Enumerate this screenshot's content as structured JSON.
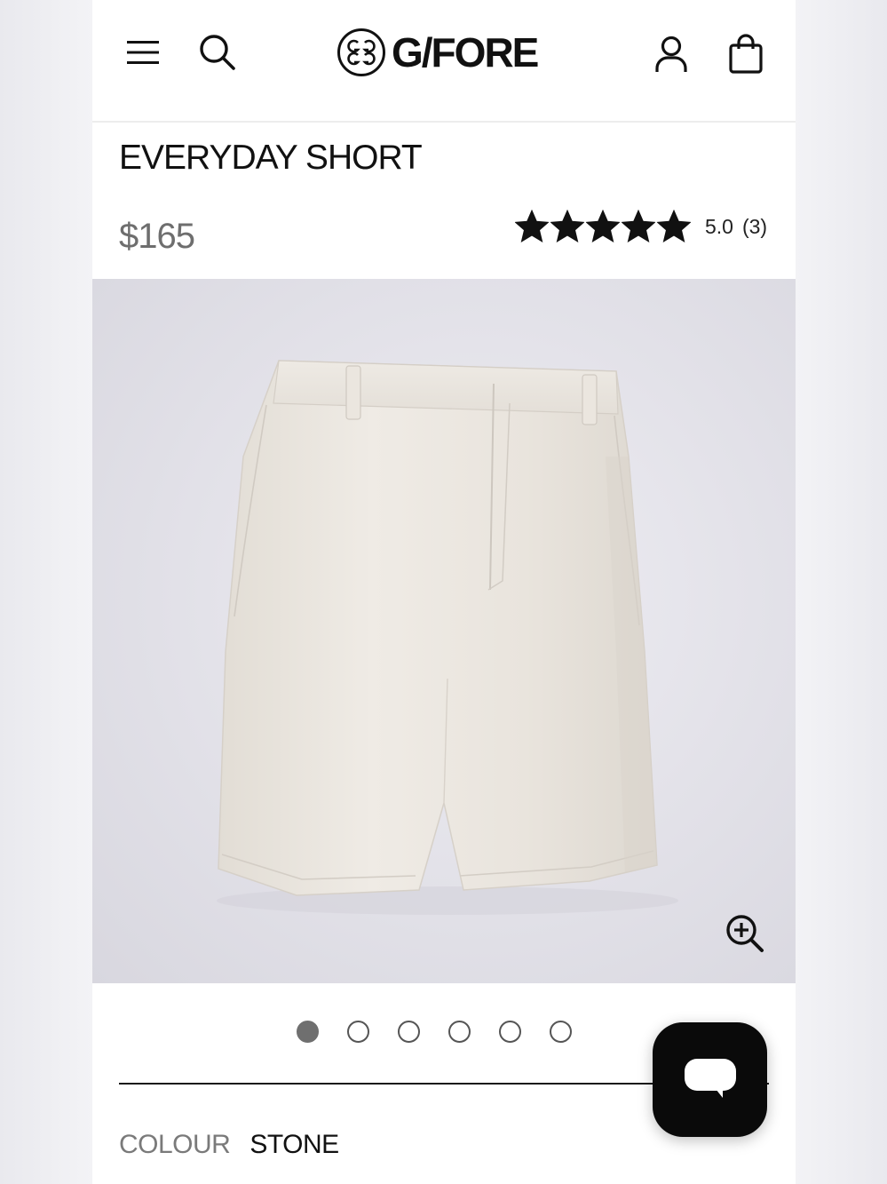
{
  "brand": {
    "name": "G/FORE"
  },
  "header": {
    "menu_icon": "hamburger-menu-icon",
    "search_icon": "search-icon",
    "account_icon": "user-icon",
    "bag_icon": "shopping-bag-icon"
  },
  "product": {
    "title": "EVERYDAY SHORT",
    "price": "$165",
    "rating": {
      "stars": 5,
      "max_stars": 5,
      "value": "5.0",
      "count": "(3)"
    },
    "image": {
      "alt": "Stone everyday short",
      "zoom_icon": "zoom-in-icon"
    },
    "gallery": {
      "total": 6,
      "active_index": 0
    },
    "colour": {
      "label": "COLOUR",
      "value": "STONE"
    }
  },
  "chat": {
    "icon": "chat-bubble-icon"
  },
  "colors": {
    "text_primary": "#111111",
    "text_muted": "#6e6e6e",
    "chat_bg": "#0a0a0a",
    "product_fabric": "#ebe6df",
    "image_bg": "#e2e1e8"
  }
}
